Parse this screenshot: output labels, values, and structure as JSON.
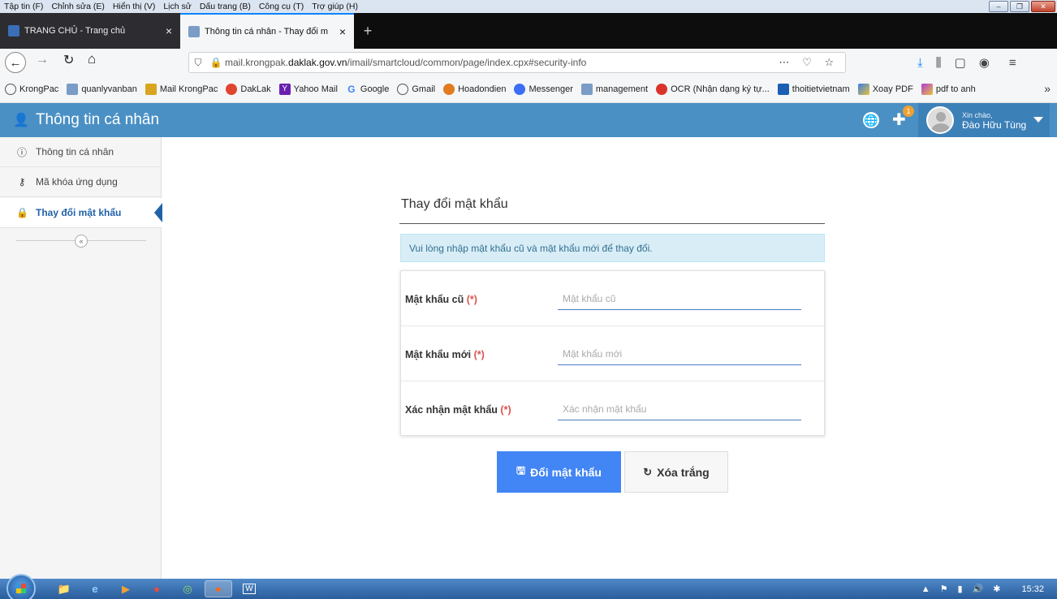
{
  "menubar": {
    "items": [
      "Tập tin (F)",
      "Chỉnh sửa (E)",
      "Hiển thị (V)",
      "Lịch sử",
      "Dấu trang (B)",
      "Công cụ (T)",
      "Trợ giúp (H)"
    ]
  },
  "tabs": [
    {
      "label": "TRANG CHỦ - Trang chủ",
      "close": "×"
    },
    {
      "label": "Thông tin cá nhân - Thay đổi m",
      "close": "×"
    }
  ],
  "newtab": "+",
  "url": {
    "prefix": "mail.krongpak.",
    "domain": "daklak.gov.vn",
    "path": "/imail/smartcloud/common/page/index.cpx#security-info"
  },
  "bookmarks": [
    {
      "label": "KrongPac",
      "color": "#555"
    },
    {
      "label": "quanlyvanban",
      "color": "#7a9cc6"
    },
    {
      "label": "Mail KrongPac",
      "color": "#d9a520"
    },
    {
      "label": "DakLak",
      "color": "#e0452f"
    },
    {
      "label": "Yahoo Mail",
      "color": "#6a1fb0"
    },
    {
      "label": "Google",
      "color": "#4285f4"
    },
    {
      "label": "Gmail",
      "color": "#555"
    },
    {
      "label": "Hoadondien",
      "color": "#e07b1f"
    },
    {
      "label": "Messenger",
      "color": "#3b6ef5"
    },
    {
      "label": "management",
      "color": "#7a9cc6"
    },
    {
      "label": "OCR (Nhận dạng ký tự...",
      "color": "#d9342b"
    },
    {
      "label": "thoitietvietnam",
      "color": "#1a5fb4"
    },
    {
      "label": "Xoay PDF",
      "color": "#3a7ee8"
    },
    {
      "label": "pdf to anh",
      "color": "#b03ad9"
    }
  ],
  "bookmarks_more": "»",
  "app": {
    "title": "Thông tin cá nhân",
    "badge_count": "1",
    "greeting": "Xin chào,",
    "username": "Đào Hữu Tùng",
    "header_color": "#4a90c4"
  },
  "sidebar": {
    "items": [
      {
        "label": "Thông tin cá nhân"
      },
      {
        "label": "Mã khóa ứng dụng"
      },
      {
        "label": "Thay đổi mật khẩu"
      }
    ],
    "collapse": "«"
  },
  "form": {
    "title": "Thay đổi mật khẩu",
    "alert": "Vui lòng nhập mật khẩu cũ và mật khẩu mới để thay đổi.",
    "required_mark": "(*)",
    "fields": [
      {
        "label": "Mật khẩu cũ",
        "placeholder": "Mật khẩu cũ",
        "value": ""
      },
      {
        "label": "Mật khẩu mới",
        "placeholder": "Mật khẩu mới",
        "value": ""
      },
      {
        "label": "Xác nhận mật khẩu",
        "placeholder": "Xác nhận mật khẩu",
        "value": ""
      }
    ],
    "save_label": "Đổi mật khẩu",
    "clear_label": "Xóa trắng",
    "accent": "#4285f4"
  },
  "taskbar": {
    "clock": "15:32"
  }
}
